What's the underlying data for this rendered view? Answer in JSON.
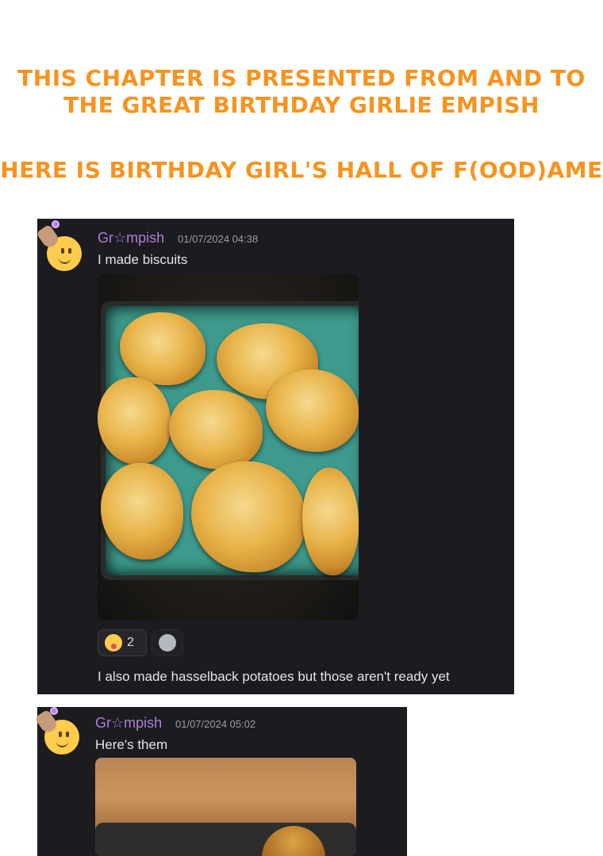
{
  "headings": {
    "dedication": "This chapter is presented from and to the great birthday girlie Empish",
    "hall": "Here is birthday girl's hall of f(ood)ame"
  },
  "messages": [
    {
      "username": "Gr☆mpish",
      "timestamp": "01/07/2024 04:38",
      "text": "I made biscuits",
      "reaction": {
        "emoji": "yum-face-icon",
        "count": "2"
      },
      "followup": "I also made hasselback potatoes but those aren't ready yet"
    },
    {
      "username": "Gr☆mpish",
      "timestamp": "01/07/2024 05:02",
      "text": "Here's them"
    }
  ],
  "colors": {
    "heading": "#f7931e",
    "chat_bg": "#1b1b20",
    "username": "#b07fd6"
  }
}
